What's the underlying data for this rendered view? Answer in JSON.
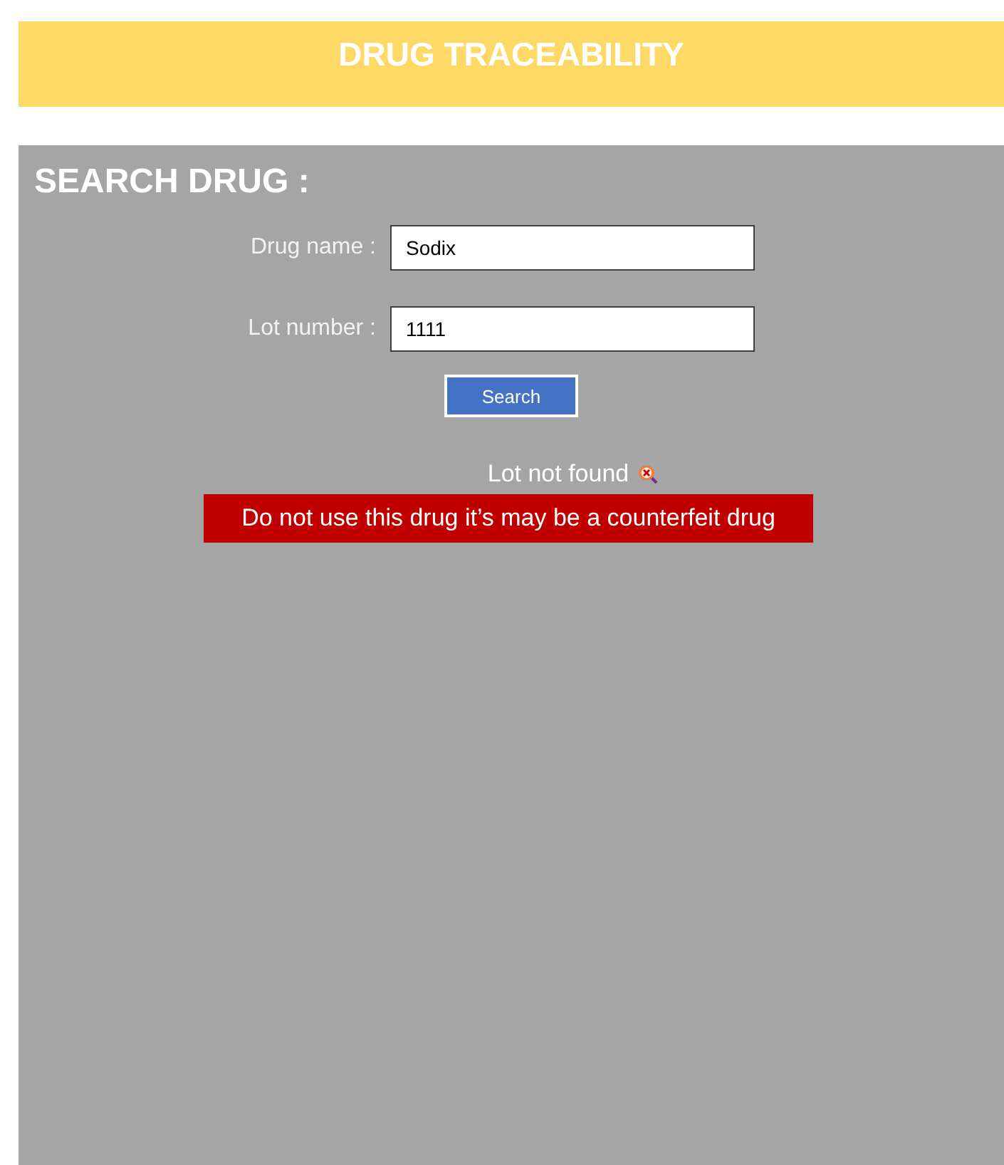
{
  "header": {
    "title": "DRUG TRACEABILITY"
  },
  "search_panel": {
    "title": "SEARCH DRUG :",
    "fields": [
      {
        "label": "Drug name :",
        "value": "Sodix"
      },
      {
        "label": "Lot number :",
        "value": "1111"
      }
    ],
    "search_button": "Search",
    "result": {
      "message": "Lot not found",
      "warning": "Do not use this drug it’s may be a counterfeit drug"
    }
  }
}
